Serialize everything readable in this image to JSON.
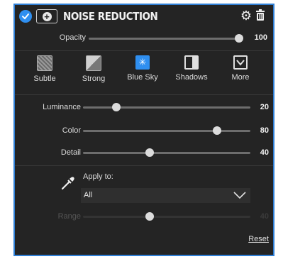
{
  "panel": {
    "title": "NOISE REDUCTION",
    "enabled": true,
    "accent_color": "#2f8ff0",
    "icons": [
      "check-circle-icon",
      "plus-icon",
      "gear-icon",
      "trash-icon"
    ]
  },
  "opacity": {
    "label": "Opacity",
    "value": "100",
    "level": 1.0
  },
  "presets": [
    {
      "label": "Subtle",
      "icon": "subtle-texture-icon",
      "active": false
    },
    {
      "label": "Strong",
      "icon": "strong-texture-icon",
      "active": false
    },
    {
      "label": "Blue Sky",
      "icon": "blue-sky-icon",
      "active": true
    },
    {
      "label": "Shadows",
      "icon": "shadows-icon",
      "active": false
    },
    {
      "label": "More",
      "icon": "chevron-down-box-icon",
      "active": false
    }
  ],
  "sliders": [
    {
      "label": "Luminance",
      "value": "20",
      "level": 0.2
    },
    {
      "label": "Color",
      "value": "80",
      "level": 0.8
    },
    {
      "label": "Detail",
      "value": "40",
      "level": 0.4
    }
  ],
  "apply_to": {
    "label": "Apply to:",
    "selected": "All",
    "icon": "eyedropper-icon"
  },
  "range": {
    "label": "Range",
    "value": "40",
    "level": 0.4,
    "disabled": true
  },
  "reset_label": "Reset"
}
